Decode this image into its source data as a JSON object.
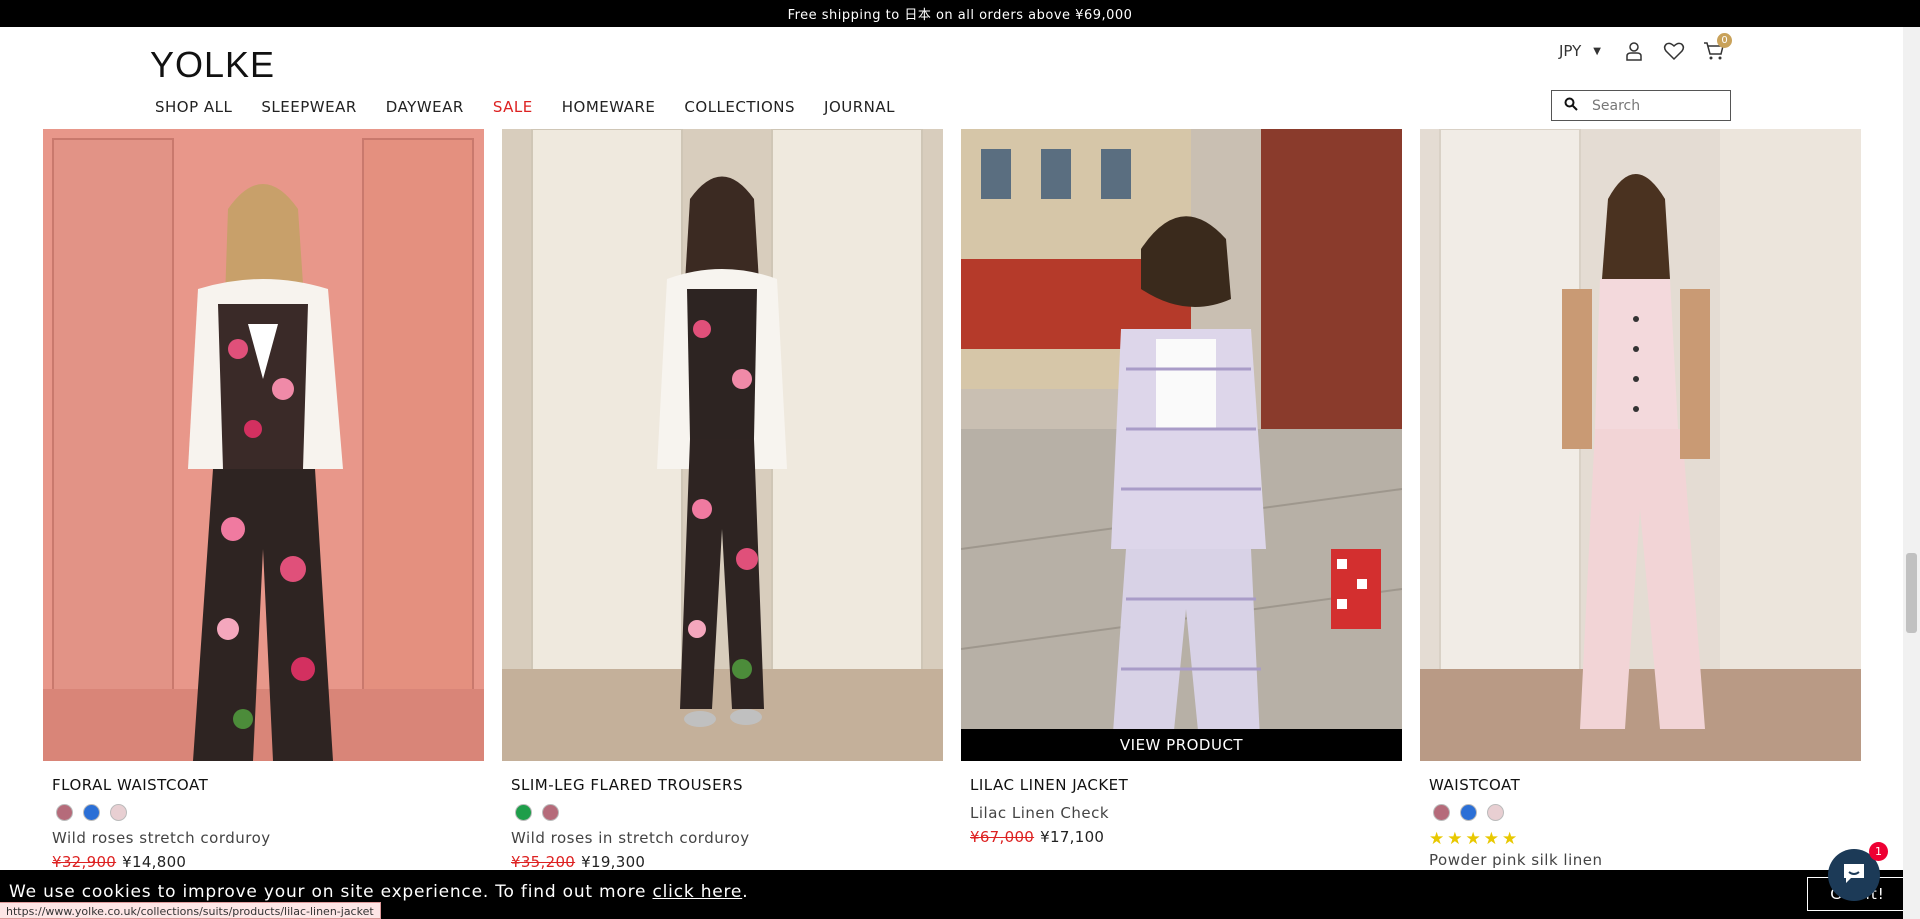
{
  "promo": {
    "text": "Free shipping to 日本 on all orders above ¥69,000"
  },
  "header": {
    "logo": "YOLKE",
    "currency": "JPY",
    "cart_count": "0",
    "search_placeholder": "Search"
  },
  "nav": {
    "items": [
      {
        "label": "SHOP ALL"
      },
      {
        "label": "SLEEPWEAR"
      },
      {
        "label": "DAYWEAR"
      },
      {
        "label": "SALE"
      },
      {
        "label": "HOMEWARE"
      },
      {
        "label": "COLLECTIONS"
      },
      {
        "label": "JOURNAL"
      }
    ]
  },
  "products": [
    {
      "title": "FLORAL WAISTCOAT",
      "description": "Wild roses stretch corduroy",
      "was_price": "¥32,900",
      "price": "¥14,800",
      "swatches": [
        "#b56b7a",
        "#2b6fd6",
        "#e8cfd2"
      ]
    },
    {
      "title": "SLIM-LEG FLARED TROUSERS",
      "description": "Wild roses in stretch corduroy",
      "was_price": "¥35,200",
      "price": "¥19,300",
      "swatches": [
        "#1e9e4a",
        "#b56b7a"
      ]
    },
    {
      "title": "LILAC LINEN JACKET",
      "description": "Lilac Linen Check",
      "was_price": "¥67,000",
      "price": "¥17,100",
      "hover_label": "VIEW PRODUCT"
    },
    {
      "title": "WAISTCOAT",
      "description": "Powder pink silk linen",
      "rating": 5,
      "swatches": [
        "#b56b7a",
        "#2b6fd6",
        "#e8cfd2"
      ]
    }
  ],
  "cookie": {
    "text": "We use cookies to improve your on site experience. To find out more ",
    "link": "click here",
    "suffix": ".",
    "button": "Got it!"
  },
  "status_url": "https://www.yolke.co.uk/collections/suits/products/lilac-linen-jacket",
  "chat": {
    "badge": "1"
  }
}
